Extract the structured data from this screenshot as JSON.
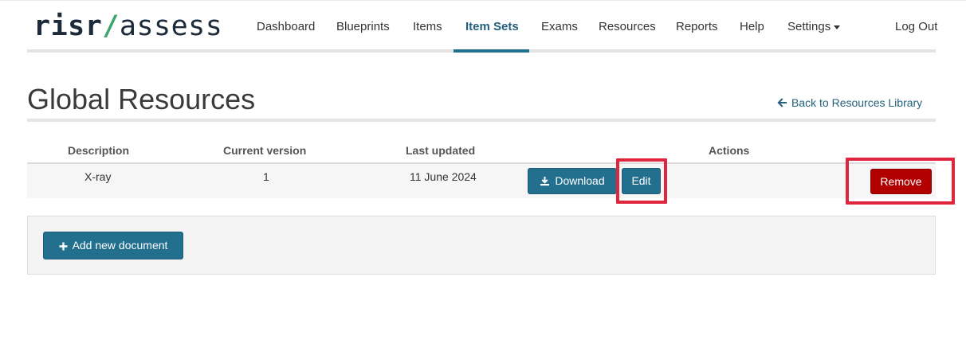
{
  "brand": {
    "name": "risr",
    "separator": "/",
    "product": "assess"
  },
  "nav": {
    "items": [
      {
        "label": "Dashboard"
      },
      {
        "label": "Blueprints"
      },
      {
        "label": "Items"
      },
      {
        "label": "Item Sets",
        "active": true
      },
      {
        "label": "Exams"
      },
      {
        "label": "Resources"
      },
      {
        "label": "Reports"
      },
      {
        "label": "Help"
      },
      {
        "label": "Settings",
        "dropdown": true
      }
    ],
    "logout": "Log Out"
  },
  "page": {
    "title": "Global Resources",
    "back_link": "Back to Resources Library"
  },
  "table": {
    "headers": [
      "Description",
      "Current version",
      "Last updated",
      "Actions"
    ],
    "rows": [
      {
        "description": "X-ray",
        "version": "1",
        "last_updated": "11 June 2024",
        "actions": {
          "download": "Download",
          "edit": "Edit",
          "remove": "Remove"
        }
      }
    ]
  },
  "add_document": "Add new document",
  "colors": {
    "primary": "#236f8e",
    "danger": "#b20000",
    "highlight": "#e0253f",
    "logo_slash": "#3aa76d",
    "nav_active": "#23607d"
  },
  "icons": {
    "back": "arrow-left-icon",
    "download": "download-icon",
    "add": "plus-icon",
    "settings_dropdown": "caret-down-icon"
  }
}
